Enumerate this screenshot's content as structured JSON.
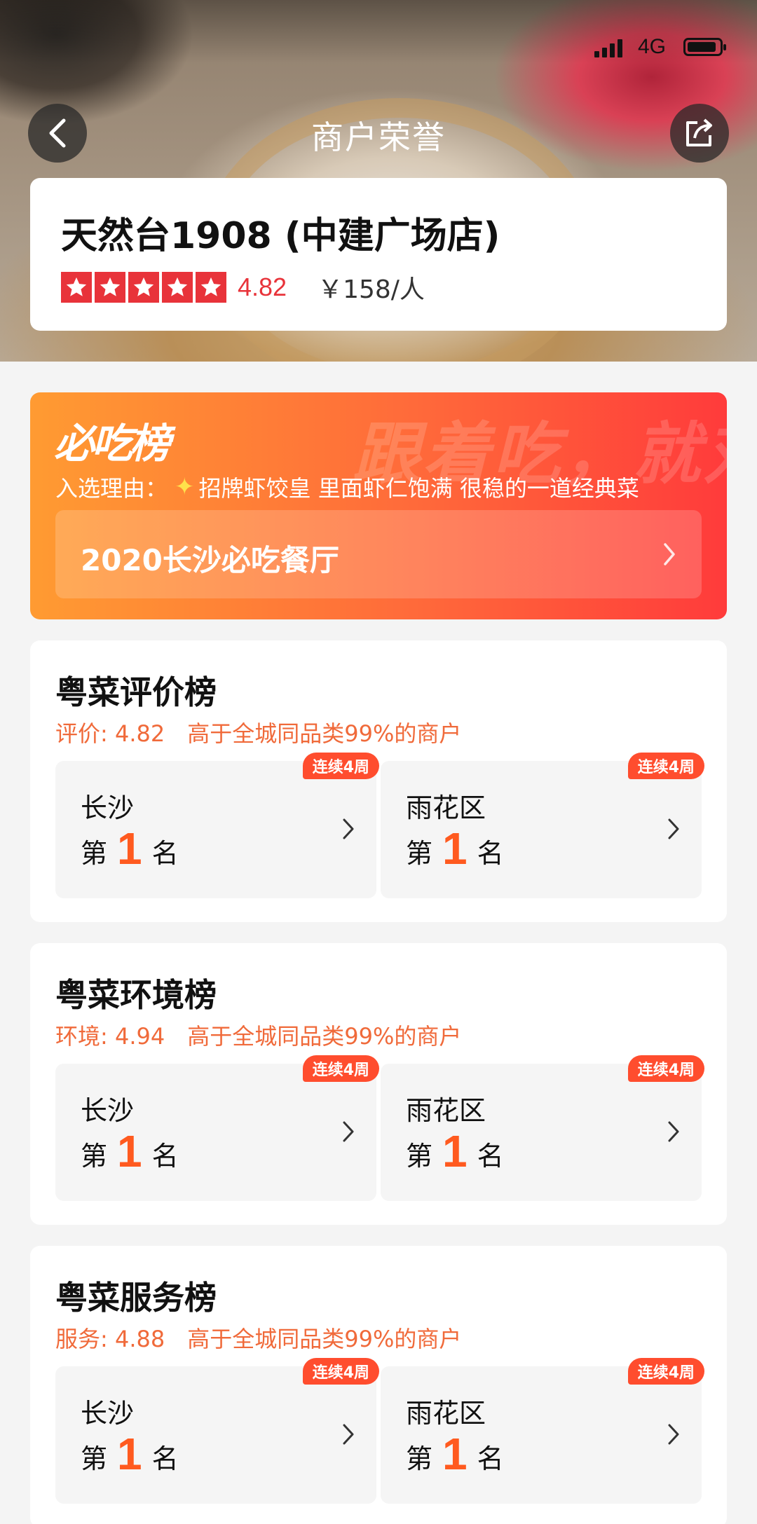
{
  "status_bar": {
    "network": "4G"
  },
  "header": {
    "title": "商户荣誉"
  },
  "shop": {
    "name": "天然台1908 (中建广场店)",
    "rating": "4.82",
    "stars": 5,
    "price": "￥158/人"
  },
  "must_eat": {
    "logo": "必吃榜",
    "slogan": "跟着吃，就对了！",
    "reason_label": "入选理由：",
    "reason_text": "招牌虾饺皇 里面虾仁饱满 很稳的一道经典菜",
    "title": "2020长沙必吃餐厅"
  },
  "rankings": [
    {
      "title": "粤菜评价榜",
      "metric": "评价: 4.82",
      "compare": "高于全城同品类99%的商户",
      "items": [
        {
          "area": "长沙",
          "prefix": "第",
          "rank": "1",
          "suffix": "名",
          "badge": "连续4周"
        },
        {
          "area": "雨花区",
          "prefix": "第",
          "rank": "1",
          "suffix": "名",
          "badge": "连续4周"
        }
      ]
    },
    {
      "title": "粤菜环境榜",
      "metric": "环境: 4.94",
      "compare": "高于全城同品类99%的商户",
      "items": [
        {
          "area": "长沙",
          "prefix": "第",
          "rank": "1",
          "suffix": "名",
          "badge": "连续4周"
        },
        {
          "area": "雨花区",
          "prefix": "第",
          "rank": "1",
          "suffix": "名",
          "badge": "连续4周"
        }
      ]
    },
    {
      "title": "粤菜服务榜",
      "metric": "服务: 4.88",
      "compare": "高于全城同品类99%的商户",
      "items": [
        {
          "area": "长沙",
          "prefix": "第",
          "rank": "1",
          "suffix": "名",
          "badge": "连续4周"
        },
        {
          "area": "雨花区",
          "prefix": "第",
          "rank": "1",
          "suffix": "名",
          "badge": "连续4周"
        }
      ]
    }
  ],
  "colors": {
    "accent": "#ff5a1f",
    "star": "#e8333a",
    "badge": "#ff4d2e",
    "subtext": "#f06a3a"
  },
  "icons": {
    "back": "chevron-left-icon",
    "share": "share-icon",
    "star": "star-icon",
    "chevron": "chevron-right-icon",
    "reason": "sparkle-icon"
  }
}
